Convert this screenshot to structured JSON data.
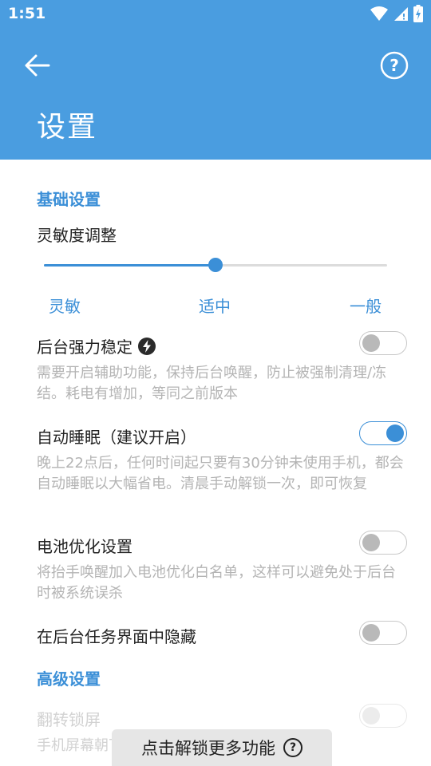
{
  "status": {
    "time": "1:51"
  },
  "header": {
    "title": "设置"
  },
  "basic": {
    "section_title": "基础设置",
    "sensitivity": {
      "title": "灵敏度调整",
      "value": 0.5,
      "labels": [
        "灵敏",
        "适中",
        "一般"
      ]
    },
    "items": [
      {
        "title": "后台强力稳定",
        "desc": "需要开启辅助功能，保持后台唤醒，防止被强制清理/冻结。耗电有增加，等同之前版本",
        "on": false
      },
      {
        "title": "自动睡眠（建议开启）",
        "desc": "晚上22点后，任何时间起只要有30分钟未使用手机，都会自动睡眠以大幅省电。清晨手动解锁一次，即可恢复",
        "on": true
      },
      {
        "title": "电池优化设置",
        "desc": "将抬手唤醒加入电池优化白名单，这样可以避免处于后台时被系统误杀",
        "on": false
      },
      {
        "title": "在后台任务界面中隐藏",
        "on": false
      }
    ]
  },
  "advanced": {
    "section_title": "高级设置",
    "items": [
      {
        "title": "翻转锁屏",
        "desc": "手机屏幕朝下放置……（可能会增加耗电）",
        "on": false
      }
    ]
  },
  "unlock": {
    "label": "点击解锁更多功能"
  },
  "colors": {
    "accent": "#3b8fd7",
    "header": "#4a9de0"
  }
}
